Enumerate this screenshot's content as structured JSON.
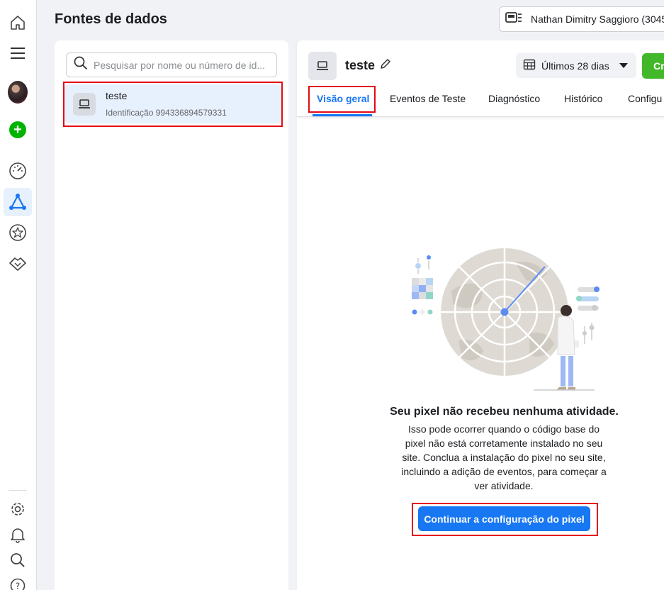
{
  "nav": {
    "items": [
      {
        "name": "home-icon"
      },
      {
        "name": "menu-icon"
      },
      {
        "name": "avatar"
      },
      {
        "name": "create-plus-icon"
      },
      {
        "name": "dashboard-gauge-icon"
      },
      {
        "name": "data-sources-icon",
        "selected": true
      },
      {
        "name": "star-icon"
      },
      {
        "name": "handshake-icon"
      },
      {
        "name": "settings-gear-icon"
      },
      {
        "name": "bell-icon"
      },
      {
        "name": "search-icon"
      },
      {
        "name": "help-icon"
      }
    ]
  },
  "header": {
    "title": "Fontes de dados",
    "account_label": "Nathan Dimitry Saggioro (3045"
  },
  "sidebar": {
    "search_placeholder": "Pesquisar por nome ou número de id...",
    "items": [
      {
        "name": "teste",
        "id_text": "Identificação 994336894579331",
        "selected": true
      }
    ]
  },
  "detail": {
    "source_name": "teste",
    "date_range": "Últimos 28 dias",
    "create_label": "Cri",
    "tabs": [
      {
        "label": "Visão geral",
        "active": true
      },
      {
        "label": "Eventos de Teste"
      },
      {
        "label": "Diagnóstico"
      },
      {
        "label": "Histórico"
      },
      {
        "label": "Configu"
      }
    ],
    "empty_title": "Seu pixel não recebeu nenhuma atividade.",
    "empty_description": "Isso pode ocorrer quando o código base do pixel não está corretamente instalado no seu site. Conclua a instalação do pixel no seu site, incluindo a adição de eventos, para começar a ver atividade.",
    "cta_label": "Continuar a configuração do pixel"
  },
  "colors": {
    "accent": "#1877f2",
    "create": "#42b72a",
    "highlight_box": "#e50914",
    "selected_bg": "#e7f0fd"
  }
}
